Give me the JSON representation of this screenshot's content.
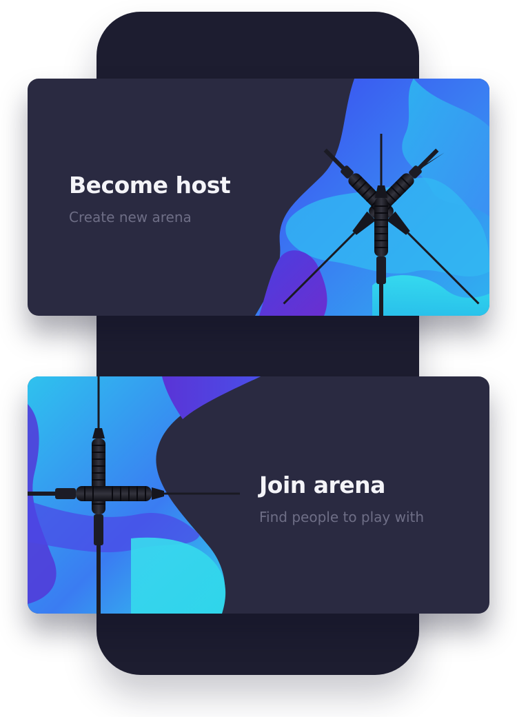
{
  "cards": [
    {
      "title": "Become host",
      "subtitle": "Create new arena"
    },
    {
      "title": "Join arena",
      "subtitle": "Find people to play with"
    }
  ],
  "colors": {
    "page_background": "#ffffff",
    "phone_background": "#1d1d30",
    "card_background": "#2a2a41",
    "title_color": "#f4f4f8",
    "subtitle_color": "#6e6e86",
    "blob_blue": "#3a5ff0",
    "blob_cyan": "#2ad0ee",
    "blob_purple": "#5a34d6",
    "dart_color": "#15151c"
  },
  "icons": [
    "dart-icon"
  ]
}
